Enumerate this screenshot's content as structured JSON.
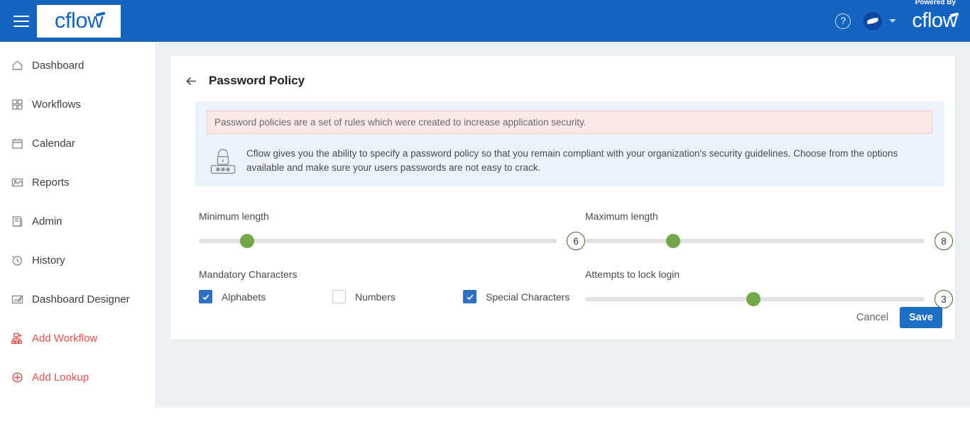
{
  "topbar": {
    "menu_icon": "hamburger-icon",
    "logo_text": "cflow",
    "help_icon": "help-circle-icon",
    "avatar_icon": "user-avatar",
    "caret_icon": "chevron-down-icon",
    "powered_by": "Powered By",
    "brand_logo": "cflow",
    "bg_color": "#1565c0"
  },
  "sidebar": {
    "items": [
      {
        "label": "Dashboard",
        "icon": "home-icon",
        "accent": false
      },
      {
        "label": "Workflows",
        "icon": "grid-icon",
        "accent": false
      },
      {
        "label": "Calendar",
        "icon": "calendar-icon",
        "accent": false
      },
      {
        "label": "Reports",
        "icon": "report-image-icon",
        "accent": false
      },
      {
        "label": "Admin",
        "icon": "book-icon",
        "accent": false
      },
      {
        "label": "History",
        "icon": "clock-history-icon",
        "accent": false
      },
      {
        "label": "Dashboard Designer",
        "icon": "dashboard-designer-icon",
        "accent": false
      },
      {
        "label": "Add Workflow",
        "icon": "add-workflow-icon",
        "accent": true
      },
      {
        "label": "Add Lookup",
        "icon": "add-lookup-icon",
        "accent": true
      }
    ],
    "accent_color": "#d9534f"
  },
  "page": {
    "back_icon": "back-arrow-icon",
    "title": "Password Policy",
    "alert_text": "Password policies are a set of rules which were created to increase application security.",
    "alert_bg": "#fbe9e7",
    "info_icon": "password-lock-icon",
    "info_text": "Cflow gives you the ability to specify a password policy so that you remain compliant with your organization's security guidelines. Choose from the options available and make sure your users passwords are not easy to crack.",
    "info_bg": "#eaf3fb"
  },
  "form": {
    "minimum_length": {
      "label": "Minimum length",
      "value": "6",
      "percent": 13.5
    },
    "maximum_length": {
      "label": "Maximum length",
      "value": "8",
      "percent": 26.0
    },
    "attempts_to_lock_login": {
      "label": "Attempts to lock login",
      "value": "3",
      "percent": 49.5
    },
    "mandatory_characters": {
      "label": "Mandatory Characters",
      "options": [
        {
          "label": "Alphabets",
          "checked": true
        },
        {
          "label": "Numbers",
          "checked": false
        },
        {
          "label": "Special Characters",
          "checked": true
        }
      ]
    },
    "slider_thumb_color": "#74a74a",
    "checkbox_color": "#2f6fc0"
  },
  "footer": {
    "cancel_label": "Cancel",
    "save_label": "Save",
    "save_color": "#1c6fc4"
  }
}
